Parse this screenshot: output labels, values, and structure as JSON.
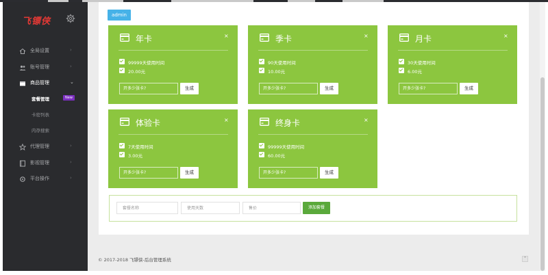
{
  "app": {
    "logo": "飞镖侠",
    "footer": "© 2017-2018 飞镖侠-后台管理系统"
  },
  "sidebar": {
    "items": [
      {
        "label": "全局设置",
        "icon": "home-icon"
      },
      {
        "label": "账号管理",
        "icon": "users-icon"
      },
      {
        "label": "商品管理",
        "icon": "box-icon"
      },
      {
        "label": "代理管理",
        "icon": "star-icon"
      },
      {
        "label": "影视管理",
        "icon": "film-icon"
      },
      {
        "label": "平台操作",
        "icon": "settings-icon"
      }
    ],
    "sub_items": [
      {
        "label": "套餐管理",
        "badge": "New"
      },
      {
        "label": "卡密列表"
      },
      {
        "label": "内存搜索"
      }
    ]
  },
  "main": {
    "user_tag": "admin",
    "cards": [
      {
        "title": "年卡",
        "line1": "99999天使用时间",
        "line2": "20.00元",
        "placeholder": "开多少张卡?",
        "button": "生成",
        "close": "×"
      },
      {
        "title": "季卡",
        "line1": "90天使用时间",
        "line2": "10.00元",
        "placeholder": "开多少张卡?",
        "button": "生成",
        "close": "×"
      },
      {
        "title": "月卡",
        "line1": "30天使用时间",
        "line2": "6.00元",
        "placeholder": "开多少张卡?",
        "button": "生成",
        "close": "×"
      },
      {
        "title": "体验卡",
        "line1": "7天使用时间",
        "line2": "3.00元",
        "placeholder": "开多少张卡?",
        "button": "生成",
        "close": "×"
      },
      {
        "title": "终身卡",
        "line1": "99999天使用时间",
        "line2": "60.00元",
        "placeholder": "开多少张卡?",
        "button": "生成",
        "close": "×"
      }
    ],
    "add_form": {
      "name_placeholder": "套餐名称",
      "days_placeholder": "使用天数",
      "price_placeholder": "售价",
      "button": "添加套餐"
    }
  },
  "colors": {
    "card_green": "#8cc63f",
    "sidebar_bg": "#2a2b2e",
    "admin_blue": "#46b2e8",
    "new_badge": "#7b2fbf",
    "add_button": "#5aa93b"
  }
}
